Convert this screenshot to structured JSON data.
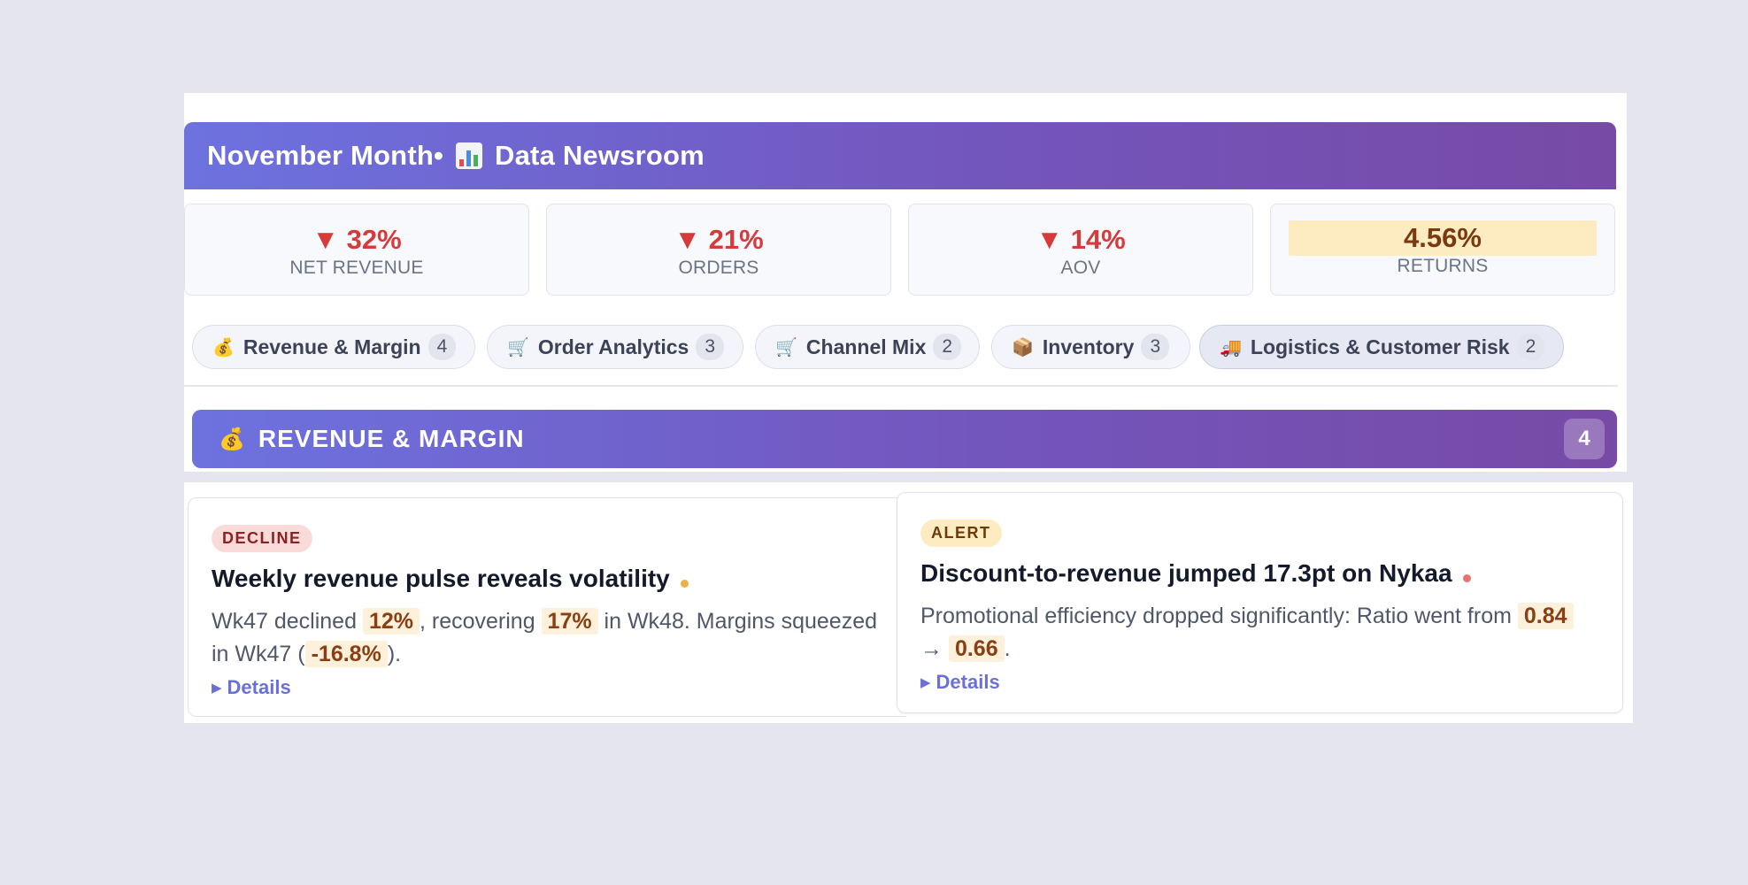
{
  "header": {
    "title_prefix": "November Month•",
    "icon": "bar-chart-icon",
    "title_suffix": "Data Newsroom"
  },
  "kpis": [
    {
      "value": "▼ 32%",
      "label": "NET REVENUE",
      "trend": "down"
    },
    {
      "value": "▼ 21%",
      "label": "ORDERS",
      "trend": "down"
    },
    {
      "value": "▼ 14%",
      "label": "AOV",
      "trend": "down"
    },
    {
      "value": "4.56%",
      "label": "RETURNS",
      "trend": "neutral"
    }
  ],
  "tabs": [
    {
      "icon": "💰",
      "icon_name": "money-bag-icon",
      "label": "Revenue & Margin",
      "count": "4"
    },
    {
      "icon": "🛒",
      "icon_name": "shopping-cart-icon",
      "label": "Order Analytics",
      "count": "3"
    },
    {
      "icon": "🛒",
      "icon_name": "shopping-cart-icon",
      "label": "Channel Mix",
      "count": "2"
    },
    {
      "icon": "📦",
      "icon_name": "package-icon",
      "label": "Inventory",
      "count": "3"
    },
    {
      "icon": "🚚",
      "icon_name": "delivery-truck-icon",
      "label": "Logistics & Customer Risk",
      "count": "2"
    }
  ],
  "section": {
    "icon": "💰",
    "title": "REVENUE & MARGIN",
    "count": "4"
  },
  "cards": [
    {
      "tag": "DECLINE",
      "title": "Weekly revenue pulse reveals volatility",
      "body": {
        "t1": "Wk47 declined ",
        "h1": "12%",
        "t2": ", recovering ",
        "h2": "17%",
        "t3": " in Wk48. Margins squeezed in Wk47 (",
        "h3": "-16.8%",
        "t4": ")."
      },
      "details": "Details"
    },
    {
      "tag": "ALERT",
      "title": "Discount-to-revenue jumped 17.3pt on Nykaa",
      "body": {
        "t1": "Promotional efficiency dropped significantly: Ratio went from ",
        "h1": "0.84",
        "t2": " → ",
        "h2": "0.66",
        "t3": "."
      },
      "details": "Details"
    }
  ],
  "colors": {
    "accent_start": "#6d72df",
    "accent_end": "#774aa6",
    "decline": "#d63a3a",
    "highlight_bg": "#fdf1dc"
  }
}
